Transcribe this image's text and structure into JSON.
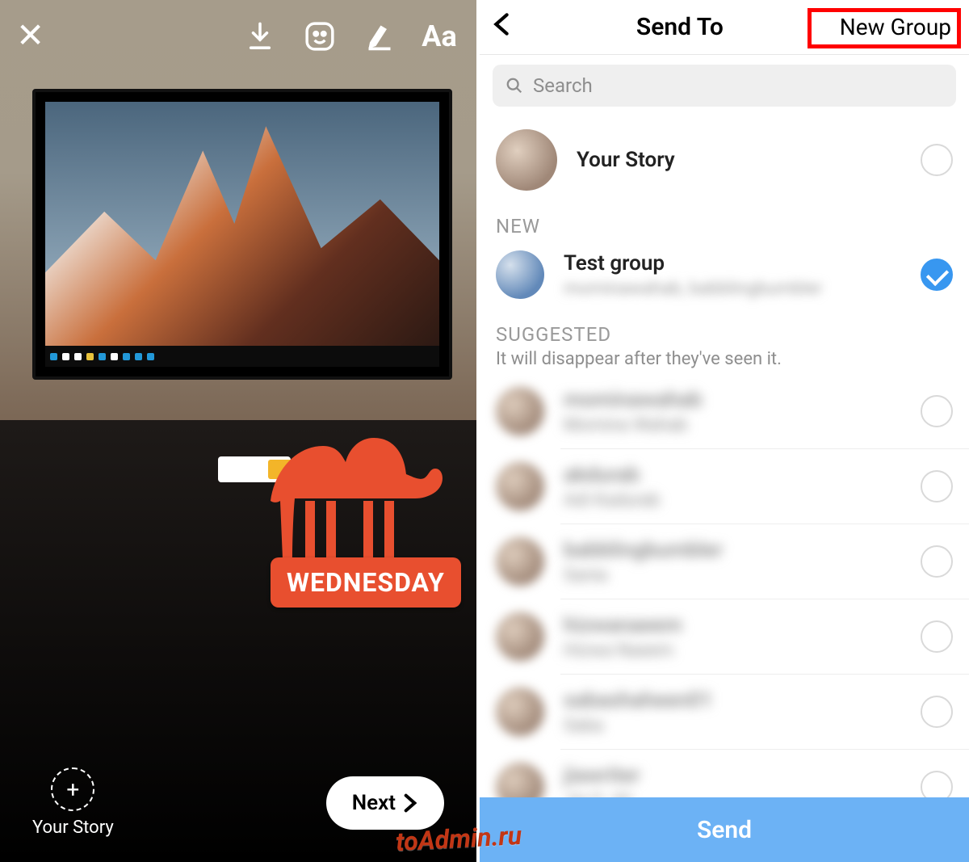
{
  "left": {
    "your_story_label": "Your Story",
    "next_label": "Next",
    "day_sticker": "WEDNESDAY",
    "text_tool_label": "Aa"
  },
  "right": {
    "title": "Send To",
    "new_group": "New Group",
    "search_placeholder": "Search",
    "your_story_row": "Your Story",
    "section_new": "NEW",
    "new_group_row": {
      "name": "Test group",
      "members": "mominawahab, babblingbumbler"
    },
    "section_suggested": "SUGGESTED",
    "suggested_note": "It will disappear after they've seen it.",
    "suggested": [
      {
        "name": "mominawahab",
        "sub": "Momina Wahab"
      },
      {
        "name": "akdurab",
        "sub": "Adi Kadurab"
      },
      {
        "name": "babblingbumbler",
        "sub": "Sania"
      },
      {
        "name": "hizwanaeem",
        "sub": "Hizwa Naeem"
      },
      {
        "name": "sabashaheen01",
        "sub": "Saba"
      },
      {
        "name": "jiawriter",
        "sub": "Jia S. Ali"
      }
    ],
    "send_label": "Send"
  },
  "watermark": "toAdmin.ru",
  "colors": {
    "accent": "#3897f0",
    "sticker": "#e84f2f",
    "send_bar": "#6cb2f5"
  }
}
